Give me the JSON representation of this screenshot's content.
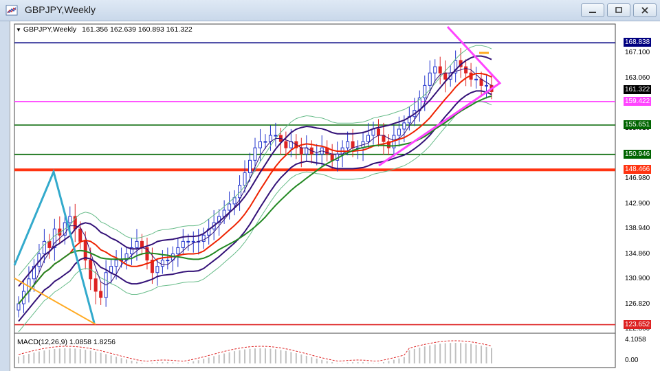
{
  "window": {
    "title": "GBPJPY,Weekly",
    "minimize_label": "minimize",
    "restore_label": "restore",
    "close_label": "close"
  },
  "chart": {
    "symbol_info": "GBPJPY,Weekly",
    "ohlc": "161.356 162.639 160.893 161.322",
    "macd_info": "MACD(12,26,9) 1.0858 1.8256"
  },
  "price_axis": {
    "ticks": [
      {
        "label": "167.100",
        "value": 167.1
      },
      {
        "label": "163.060",
        "value": 163.06
      },
      {
        "label": "155.010",
        "value": 155.01
      },
      {
        "label": "146.980",
        "value": 146.98
      },
      {
        "label": "142.900",
        "value": 142.9
      },
      {
        "label": "138.940",
        "value": 138.94
      },
      {
        "label": "134.860",
        "value": 134.86
      },
      {
        "label": "130.900",
        "value": 130.9
      },
      {
        "label": "126.820",
        "value": 126.82
      },
      {
        "label": "122.860",
        "value": 122.86
      }
    ],
    "range": [
      122.5,
      170.3
    ]
  },
  "macd_axis": {
    "ticks": [
      {
        "label": "4.1058",
        "value": 4.1058
      },
      {
        "label": "0.00",
        "value": 0
      }
    ]
  },
  "levels": [
    {
      "label": "168.838",
      "value": 168.838,
      "color": "#000080",
      "text_color": "#ffffff",
      "width": 1.6
    },
    {
      "label": "159.422",
      "value": 159.422,
      "color": "#ff44ff",
      "text_color": "#ffffff",
      "width": 1.6
    },
    {
      "label": "155.651",
      "value": 155.651,
      "color": "#006400",
      "text_color": "#ffffff",
      "width": 1.6
    },
    {
      "label": "150.946",
      "value": 150.946,
      "color": "#006400",
      "text_color": "#ffffff",
      "width": 1.6
    },
    {
      "label": "148.466",
      "value": 148.466,
      "color": "#ff3311",
      "text_color": "#ffffff",
      "width": 4
    },
    {
      "label": "123.652",
      "value": 123.652,
      "color": "#dd2222",
      "text_color": "#ffffff",
      "width": 1.6
    }
  ],
  "current_price": {
    "label": "161.322",
    "value": 161.322,
    "color": "#000000"
  },
  "colors": {
    "bull": "#2233cc",
    "bear": "#dd2222",
    "ma_fast": "#ee2200",
    "ma_slow": "#228822",
    "bb_inner": "#331177",
    "bb_outer": "#66bb88",
    "trend_cyan": "#33aacc",
    "trend_orange": "#ffaa22",
    "triangle": "#ff44ff",
    "macd_hist": "#c0c0c0",
    "macd_signal": "#dd2222"
  },
  "chart_data": {
    "type": "candlestick",
    "series_close": [
      127,
      129,
      131,
      133,
      135,
      137,
      136,
      139,
      138,
      140,
      141,
      139,
      137,
      134,
      131,
      129,
      128,
      132,
      133,
      134,
      134,
      135,
      136,
      137,
      136,
      134,
      132,
      133,
      134,
      134,
      135,
      136,
      137,
      137,
      137,
      137,
      138,
      139,
      140,
      141,
      142,
      143,
      144,
      146,
      148,
      150,
      152,
      153,
      153,
      154,
      154,
      153,
      152,
      153,
      152,
      151,
      152,
      151,
      151,
      152,
      151,
      150,
      151,
      152,
      153,
      152,
      152,
      153,
      154,
      155,
      154,
      153,
      152,
      154,
      155,
      156,
      157,
      158,
      160,
      162,
      164,
      165,
      164,
      163,
      164,
      166,
      165,
      164,
      163,
      163,
      162,
      162,
      161
    ],
    "ylim": [
      122.5,
      170.3
    ]
  }
}
